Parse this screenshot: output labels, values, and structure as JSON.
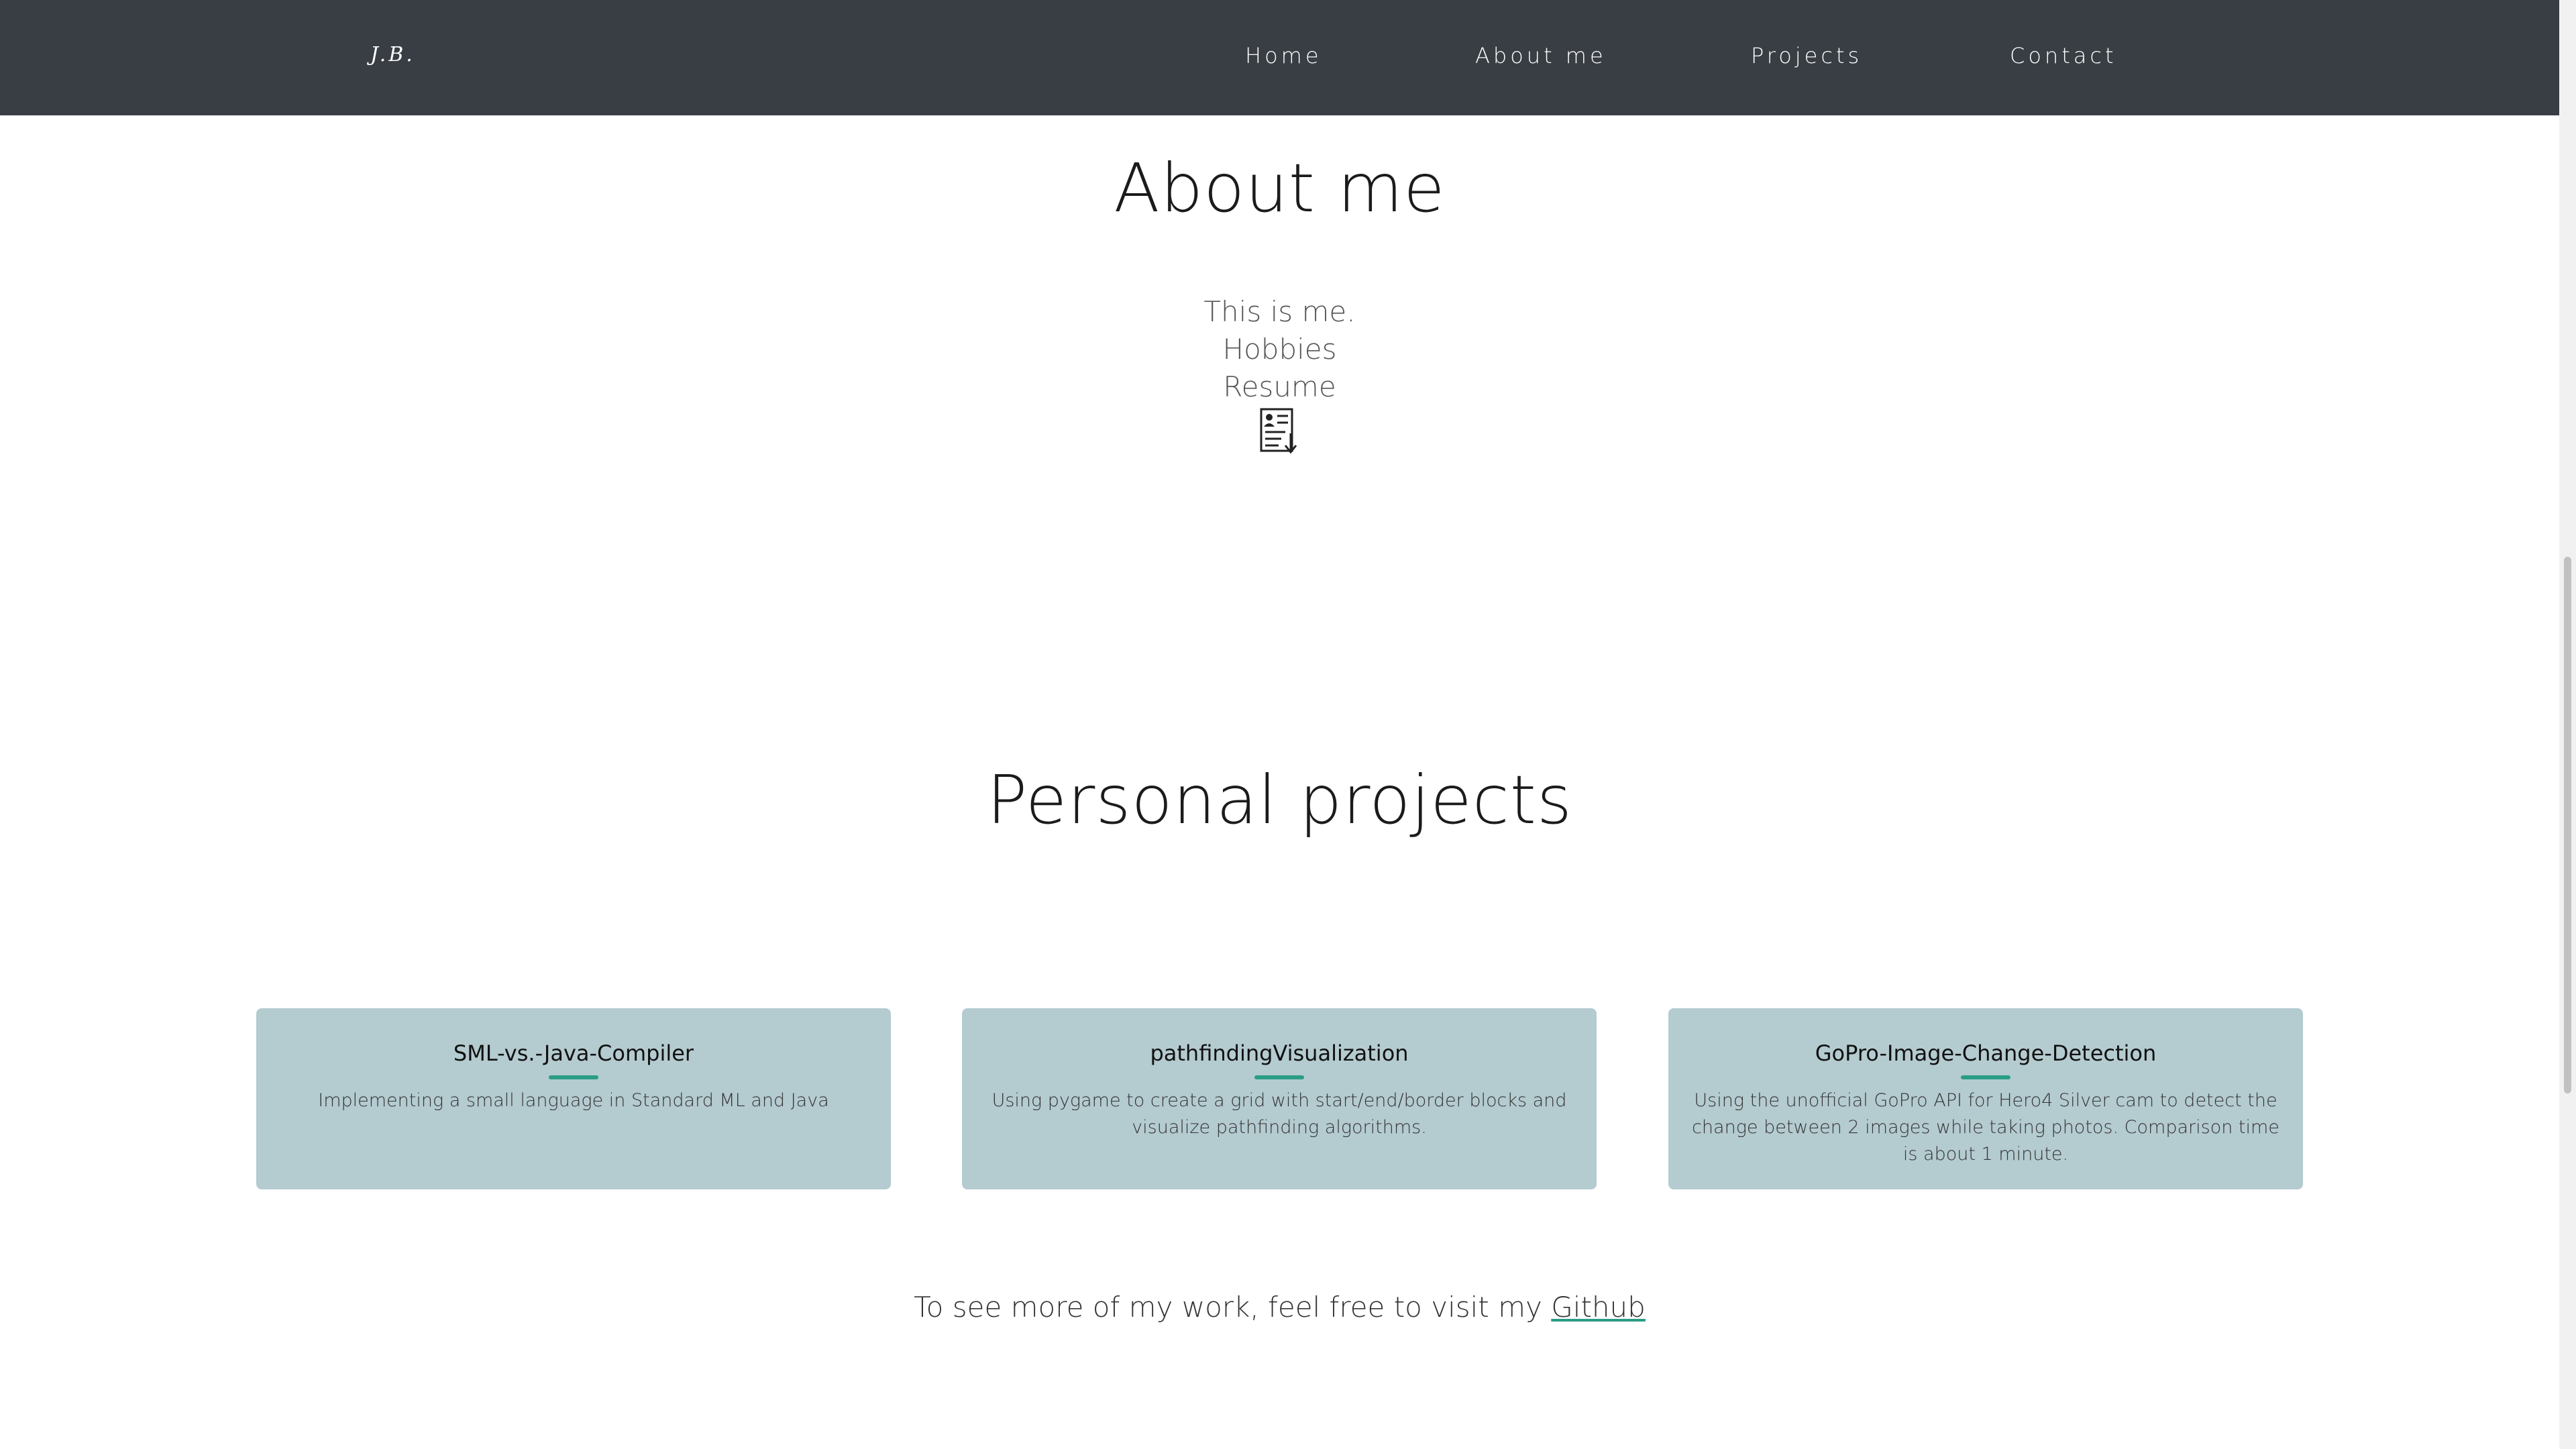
{
  "header": {
    "brand": "J.B.",
    "nav": [
      {
        "label": "Home"
      },
      {
        "label": "About me"
      },
      {
        "label": "Projects"
      },
      {
        "label": "Contact"
      }
    ]
  },
  "about": {
    "title": "About me",
    "lines": [
      "This is me.",
      "Hobbies",
      "Resume"
    ],
    "resume_icon": "resume-download-icon"
  },
  "projects": {
    "title": "Personal projects",
    "cards": [
      {
        "title": "SML-vs.-Java-Compiler",
        "description": "Implementing a small language in Standard ML and Java"
      },
      {
        "title": "pathfindingVisualization",
        "description": "Using pygame to create a grid with start/end/border blocks and visualize pathfinding algorithms."
      },
      {
        "title": "GoPro-Image-Change-Detection",
        "description": "Using the unofficial GoPro API for Hero4 Silver cam to detect the change between 2 images while taking photos. Comparison time is about 1 minute."
      }
    ]
  },
  "footer": {
    "text": "To see more of my work, feel free to visit my ",
    "link_label": "Github"
  },
  "colors": {
    "navbar_bg": "#393e44",
    "card_bg": "#b4cbd0",
    "accent": "#2a9d86"
  }
}
